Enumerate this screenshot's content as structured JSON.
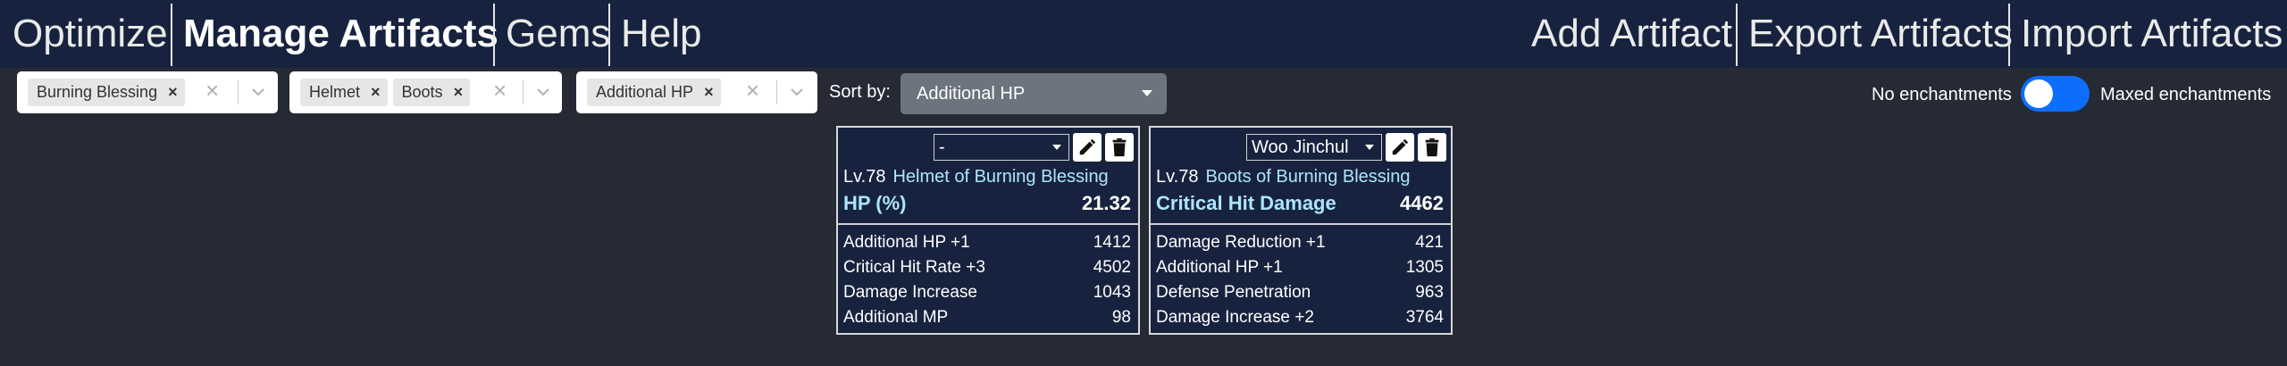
{
  "nav": {
    "left": [
      "Optimize",
      "Manage Artifacts",
      "Gems",
      "Help"
    ],
    "active": "Manage Artifacts",
    "right": [
      "Add Artifact",
      "Export Artifacts",
      "Import Artifacts"
    ]
  },
  "filters": {
    "set_filter": {
      "chips": [
        "Burning Blessing"
      ]
    },
    "slot_filter": {
      "chips": [
        "Helmet",
        "Boots"
      ]
    },
    "stat_filter": {
      "chips": [
        "Additional HP"
      ]
    },
    "chip_remove_glyph": "×",
    "clear_glyph": "×"
  },
  "sort": {
    "label": "Sort by:",
    "value": "Additional HP"
  },
  "enchant_toggle": {
    "left_label": "No enchantments",
    "right_label": "Maxed enchantments",
    "on": true
  },
  "colors": {
    "nav_bg": "#17233e",
    "page_bg": "#262a35",
    "accent": "#0d6efd",
    "highlight": "#aee4ff",
    "sort_bg": "#6c757d"
  },
  "cards": [
    {
      "character": "-",
      "level": "Lv.78",
      "name": "Helmet of Burning Blessing",
      "main_stat": {
        "name": "HP (%)",
        "value": "21.32"
      },
      "substats": [
        {
          "name": "Additional HP +1",
          "value": "1412"
        },
        {
          "name": "Critical Hit Rate +3",
          "value": "4502"
        },
        {
          "name": "Damage Increase",
          "value": "1043"
        },
        {
          "name": "Additional MP",
          "value": "98"
        }
      ],
      "edit_icon": "pencil-icon",
      "delete_icon": "trash-icon"
    },
    {
      "character": "Woo Jinchul",
      "level": "Lv.78",
      "name": "Boots of Burning Blessing",
      "main_stat": {
        "name": "Critical Hit Damage",
        "value": "4462"
      },
      "substats": [
        {
          "name": "Damage Reduction +1",
          "value": "421"
        },
        {
          "name": "Additional HP +1",
          "value": "1305"
        },
        {
          "name": "Defense Penetration",
          "value": "963"
        },
        {
          "name": "Damage Increase +2",
          "value": "3764"
        }
      ],
      "edit_icon": "pencil-icon",
      "delete_icon": "trash-icon"
    }
  ]
}
